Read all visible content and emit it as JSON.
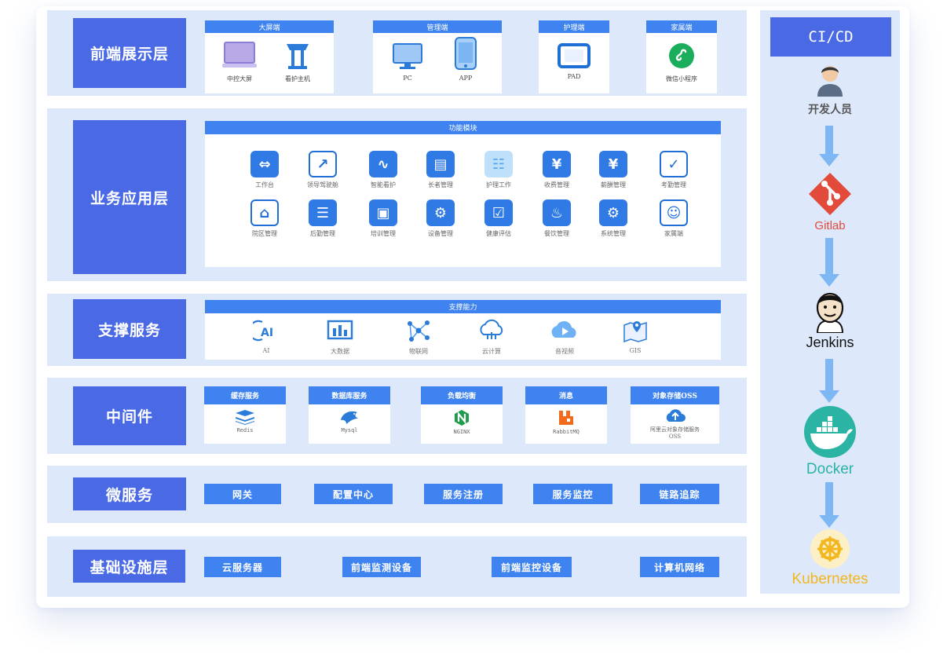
{
  "layers": {
    "frontend": {
      "label": "前端展示层",
      "groups": [
        {
          "title": "大屏端",
          "items": [
            {
              "label": "中控大屏",
              "icon": "monitor-icon"
            },
            {
              "label": "看护主机",
              "icon": "kiosk-icon"
            }
          ]
        },
        {
          "title": "管理端",
          "items": [
            {
              "label": "PC",
              "icon": "pc-icon"
            },
            {
              "label": "APP",
              "icon": "phone-icon"
            }
          ]
        },
        {
          "title": "护理端",
          "items": [
            {
              "label": "PAD",
              "icon": "tablet-icon"
            }
          ]
        },
        {
          "title": "家属端",
          "items": [
            {
              "label": "微信小程序",
              "icon": "wechat-miniprogram-icon"
            }
          ]
        }
      ]
    },
    "business": {
      "label": "业务应用层",
      "module_title": "功能模块",
      "modules": [
        "工作台",
        "领导驾驶舱",
        "智能看护",
        "长者管理",
        "护理工作",
        "收费管理",
        "薪酬管理",
        "考勤管理",
        "院区管理",
        "后勤管理",
        "培训管理",
        "设备管理",
        "健康评估",
        "餐饮管理",
        "系统管理",
        "家属端"
      ]
    },
    "support": {
      "label": "支撑服务",
      "title": "支撑能力",
      "items": [
        "AI",
        "大数据",
        "物联网",
        "云计算",
        "音视频",
        "GIS"
      ]
    },
    "middleware": {
      "label": "中间件",
      "items": [
        {
          "title": "缓存服务",
          "name": "Redis"
        },
        {
          "title": "数据库服务",
          "name": "Mysql"
        },
        {
          "title": "负载均衡",
          "name": "NGINX"
        },
        {
          "title": "消息",
          "name": "RabbitMQ"
        },
        {
          "title": "对象存储OSS",
          "name": "阿里云对象存储服务OSS"
        }
      ]
    },
    "microservice": {
      "label": "微服务",
      "items": [
        "网关",
        "配置中心",
        "服务注册",
        "服务监控",
        "链路追踪"
      ]
    },
    "infra": {
      "label": "基础设施层",
      "items": [
        "云服务器",
        "前端监测设备",
        "前端监控设备",
        "计算机网络"
      ]
    }
  },
  "cicd": {
    "title": "CI/CD",
    "steps": [
      {
        "label": "开发人员",
        "icon": "developer-icon",
        "color": "#555555"
      },
      {
        "label": "Gitlab",
        "icon": "gitlab-icon",
        "color": "#e24a3b"
      },
      {
        "label": "Jenkins",
        "icon": "jenkins-icon",
        "color": "#111111"
      },
      {
        "label": "Docker",
        "icon": "docker-icon",
        "color": "#2bb3a4"
      },
      {
        "label": "Kubernetes",
        "icon": "kubernetes-icon",
        "color": "#f2b61e"
      }
    ]
  },
  "colors": {
    "accent": "#4a6ae5",
    "header_blue": "#3f83f0",
    "panel_bg": "#dde8fb"
  }
}
